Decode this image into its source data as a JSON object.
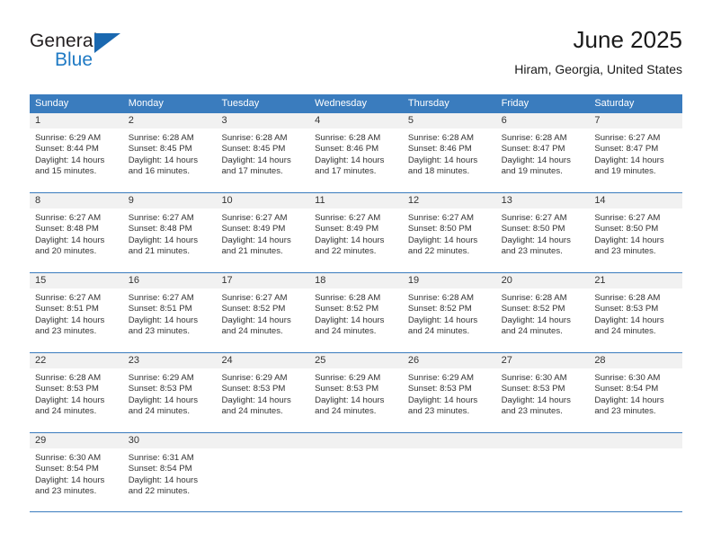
{
  "brand": {
    "word_general": "General",
    "word_blue": "Blue",
    "triangle_color": "#1a68b0",
    "blue_text_color": "#1f7ac4"
  },
  "header": {
    "title": "June 2025",
    "subtitle": "Hiram, Georgia, United States"
  },
  "theme": {
    "header_blue": "#3a7cbe",
    "daynum_band": "#f1f1f1",
    "text": "#333333"
  },
  "weekdays": [
    "Sunday",
    "Monday",
    "Tuesday",
    "Wednesday",
    "Thursday",
    "Friday",
    "Saturday"
  ],
  "weeks": [
    [
      {
        "day": "1",
        "sunrise": "Sunrise: 6:29 AM",
        "sunset": "Sunset: 8:44 PM",
        "daylight1": "Daylight: 14 hours",
        "daylight2": "and 15 minutes."
      },
      {
        "day": "2",
        "sunrise": "Sunrise: 6:28 AM",
        "sunset": "Sunset: 8:45 PM",
        "daylight1": "Daylight: 14 hours",
        "daylight2": "and 16 minutes."
      },
      {
        "day": "3",
        "sunrise": "Sunrise: 6:28 AM",
        "sunset": "Sunset: 8:45 PM",
        "daylight1": "Daylight: 14 hours",
        "daylight2": "and 17 minutes."
      },
      {
        "day": "4",
        "sunrise": "Sunrise: 6:28 AM",
        "sunset": "Sunset: 8:46 PM",
        "daylight1": "Daylight: 14 hours",
        "daylight2": "and 17 minutes."
      },
      {
        "day": "5",
        "sunrise": "Sunrise: 6:28 AM",
        "sunset": "Sunset: 8:46 PM",
        "daylight1": "Daylight: 14 hours",
        "daylight2": "and 18 minutes."
      },
      {
        "day": "6",
        "sunrise": "Sunrise: 6:28 AM",
        "sunset": "Sunset: 8:47 PM",
        "daylight1": "Daylight: 14 hours",
        "daylight2": "and 19 minutes."
      },
      {
        "day": "7",
        "sunrise": "Sunrise: 6:27 AM",
        "sunset": "Sunset: 8:47 PM",
        "daylight1": "Daylight: 14 hours",
        "daylight2": "and 19 minutes."
      }
    ],
    [
      {
        "day": "8",
        "sunrise": "Sunrise: 6:27 AM",
        "sunset": "Sunset: 8:48 PM",
        "daylight1": "Daylight: 14 hours",
        "daylight2": "and 20 minutes."
      },
      {
        "day": "9",
        "sunrise": "Sunrise: 6:27 AM",
        "sunset": "Sunset: 8:48 PM",
        "daylight1": "Daylight: 14 hours",
        "daylight2": "and 21 minutes."
      },
      {
        "day": "10",
        "sunrise": "Sunrise: 6:27 AM",
        "sunset": "Sunset: 8:49 PM",
        "daylight1": "Daylight: 14 hours",
        "daylight2": "and 21 minutes."
      },
      {
        "day": "11",
        "sunrise": "Sunrise: 6:27 AM",
        "sunset": "Sunset: 8:49 PM",
        "daylight1": "Daylight: 14 hours",
        "daylight2": "and 22 minutes."
      },
      {
        "day": "12",
        "sunrise": "Sunrise: 6:27 AM",
        "sunset": "Sunset: 8:50 PM",
        "daylight1": "Daylight: 14 hours",
        "daylight2": "and 22 minutes."
      },
      {
        "day": "13",
        "sunrise": "Sunrise: 6:27 AM",
        "sunset": "Sunset: 8:50 PM",
        "daylight1": "Daylight: 14 hours",
        "daylight2": "and 23 minutes."
      },
      {
        "day": "14",
        "sunrise": "Sunrise: 6:27 AM",
        "sunset": "Sunset: 8:50 PM",
        "daylight1": "Daylight: 14 hours",
        "daylight2": "and 23 minutes."
      }
    ],
    [
      {
        "day": "15",
        "sunrise": "Sunrise: 6:27 AM",
        "sunset": "Sunset: 8:51 PM",
        "daylight1": "Daylight: 14 hours",
        "daylight2": "and 23 minutes."
      },
      {
        "day": "16",
        "sunrise": "Sunrise: 6:27 AM",
        "sunset": "Sunset: 8:51 PM",
        "daylight1": "Daylight: 14 hours",
        "daylight2": "and 23 minutes."
      },
      {
        "day": "17",
        "sunrise": "Sunrise: 6:27 AM",
        "sunset": "Sunset: 8:52 PM",
        "daylight1": "Daylight: 14 hours",
        "daylight2": "and 24 minutes."
      },
      {
        "day": "18",
        "sunrise": "Sunrise: 6:28 AM",
        "sunset": "Sunset: 8:52 PM",
        "daylight1": "Daylight: 14 hours",
        "daylight2": "and 24 minutes."
      },
      {
        "day": "19",
        "sunrise": "Sunrise: 6:28 AM",
        "sunset": "Sunset: 8:52 PM",
        "daylight1": "Daylight: 14 hours",
        "daylight2": "and 24 minutes."
      },
      {
        "day": "20",
        "sunrise": "Sunrise: 6:28 AM",
        "sunset": "Sunset: 8:52 PM",
        "daylight1": "Daylight: 14 hours",
        "daylight2": "and 24 minutes."
      },
      {
        "day": "21",
        "sunrise": "Sunrise: 6:28 AM",
        "sunset": "Sunset: 8:53 PM",
        "daylight1": "Daylight: 14 hours",
        "daylight2": "and 24 minutes."
      }
    ],
    [
      {
        "day": "22",
        "sunrise": "Sunrise: 6:28 AM",
        "sunset": "Sunset: 8:53 PM",
        "daylight1": "Daylight: 14 hours",
        "daylight2": "and 24 minutes."
      },
      {
        "day": "23",
        "sunrise": "Sunrise: 6:29 AM",
        "sunset": "Sunset: 8:53 PM",
        "daylight1": "Daylight: 14 hours",
        "daylight2": "and 24 minutes."
      },
      {
        "day": "24",
        "sunrise": "Sunrise: 6:29 AM",
        "sunset": "Sunset: 8:53 PM",
        "daylight1": "Daylight: 14 hours",
        "daylight2": "and 24 minutes."
      },
      {
        "day": "25",
        "sunrise": "Sunrise: 6:29 AM",
        "sunset": "Sunset: 8:53 PM",
        "daylight1": "Daylight: 14 hours",
        "daylight2": "and 24 minutes."
      },
      {
        "day": "26",
        "sunrise": "Sunrise: 6:29 AM",
        "sunset": "Sunset: 8:53 PM",
        "daylight1": "Daylight: 14 hours",
        "daylight2": "and 23 minutes."
      },
      {
        "day": "27",
        "sunrise": "Sunrise: 6:30 AM",
        "sunset": "Sunset: 8:53 PM",
        "daylight1": "Daylight: 14 hours",
        "daylight2": "and 23 minutes."
      },
      {
        "day": "28",
        "sunrise": "Sunrise: 6:30 AM",
        "sunset": "Sunset: 8:54 PM",
        "daylight1": "Daylight: 14 hours",
        "daylight2": "and 23 minutes."
      }
    ],
    [
      {
        "day": "29",
        "sunrise": "Sunrise: 6:30 AM",
        "sunset": "Sunset: 8:54 PM",
        "daylight1": "Daylight: 14 hours",
        "daylight2": "and 23 minutes."
      },
      {
        "day": "30",
        "sunrise": "Sunrise: 6:31 AM",
        "sunset": "Sunset: 8:54 PM",
        "daylight1": "Daylight: 14 hours",
        "daylight2": "and 22 minutes."
      },
      {
        "day": "",
        "sunrise": "",
        "sunset": "",
        "daylight1": "",
        "daylight2": ""
      },
      {
        "day": "",
        "sunrise": "",
        "sunset": "",
        "daylight1": "",
        "daylight2": ""
      },
      {
        "day": "",
        "sunrise": "",
        "sunset": "",
        "daylight1": "",
        "daylight2": ""
      },
      {
        "day": "",
        "sunrise": "",
        "sunset": "",
        "daylight1": "",
        "daylight2": ""
      },
      {
        "day": "",
        "sunrise": "",
        "sunset": "",
        "daylight1": "",
        "daylight2": ""
      }
    ]
  ]
}
